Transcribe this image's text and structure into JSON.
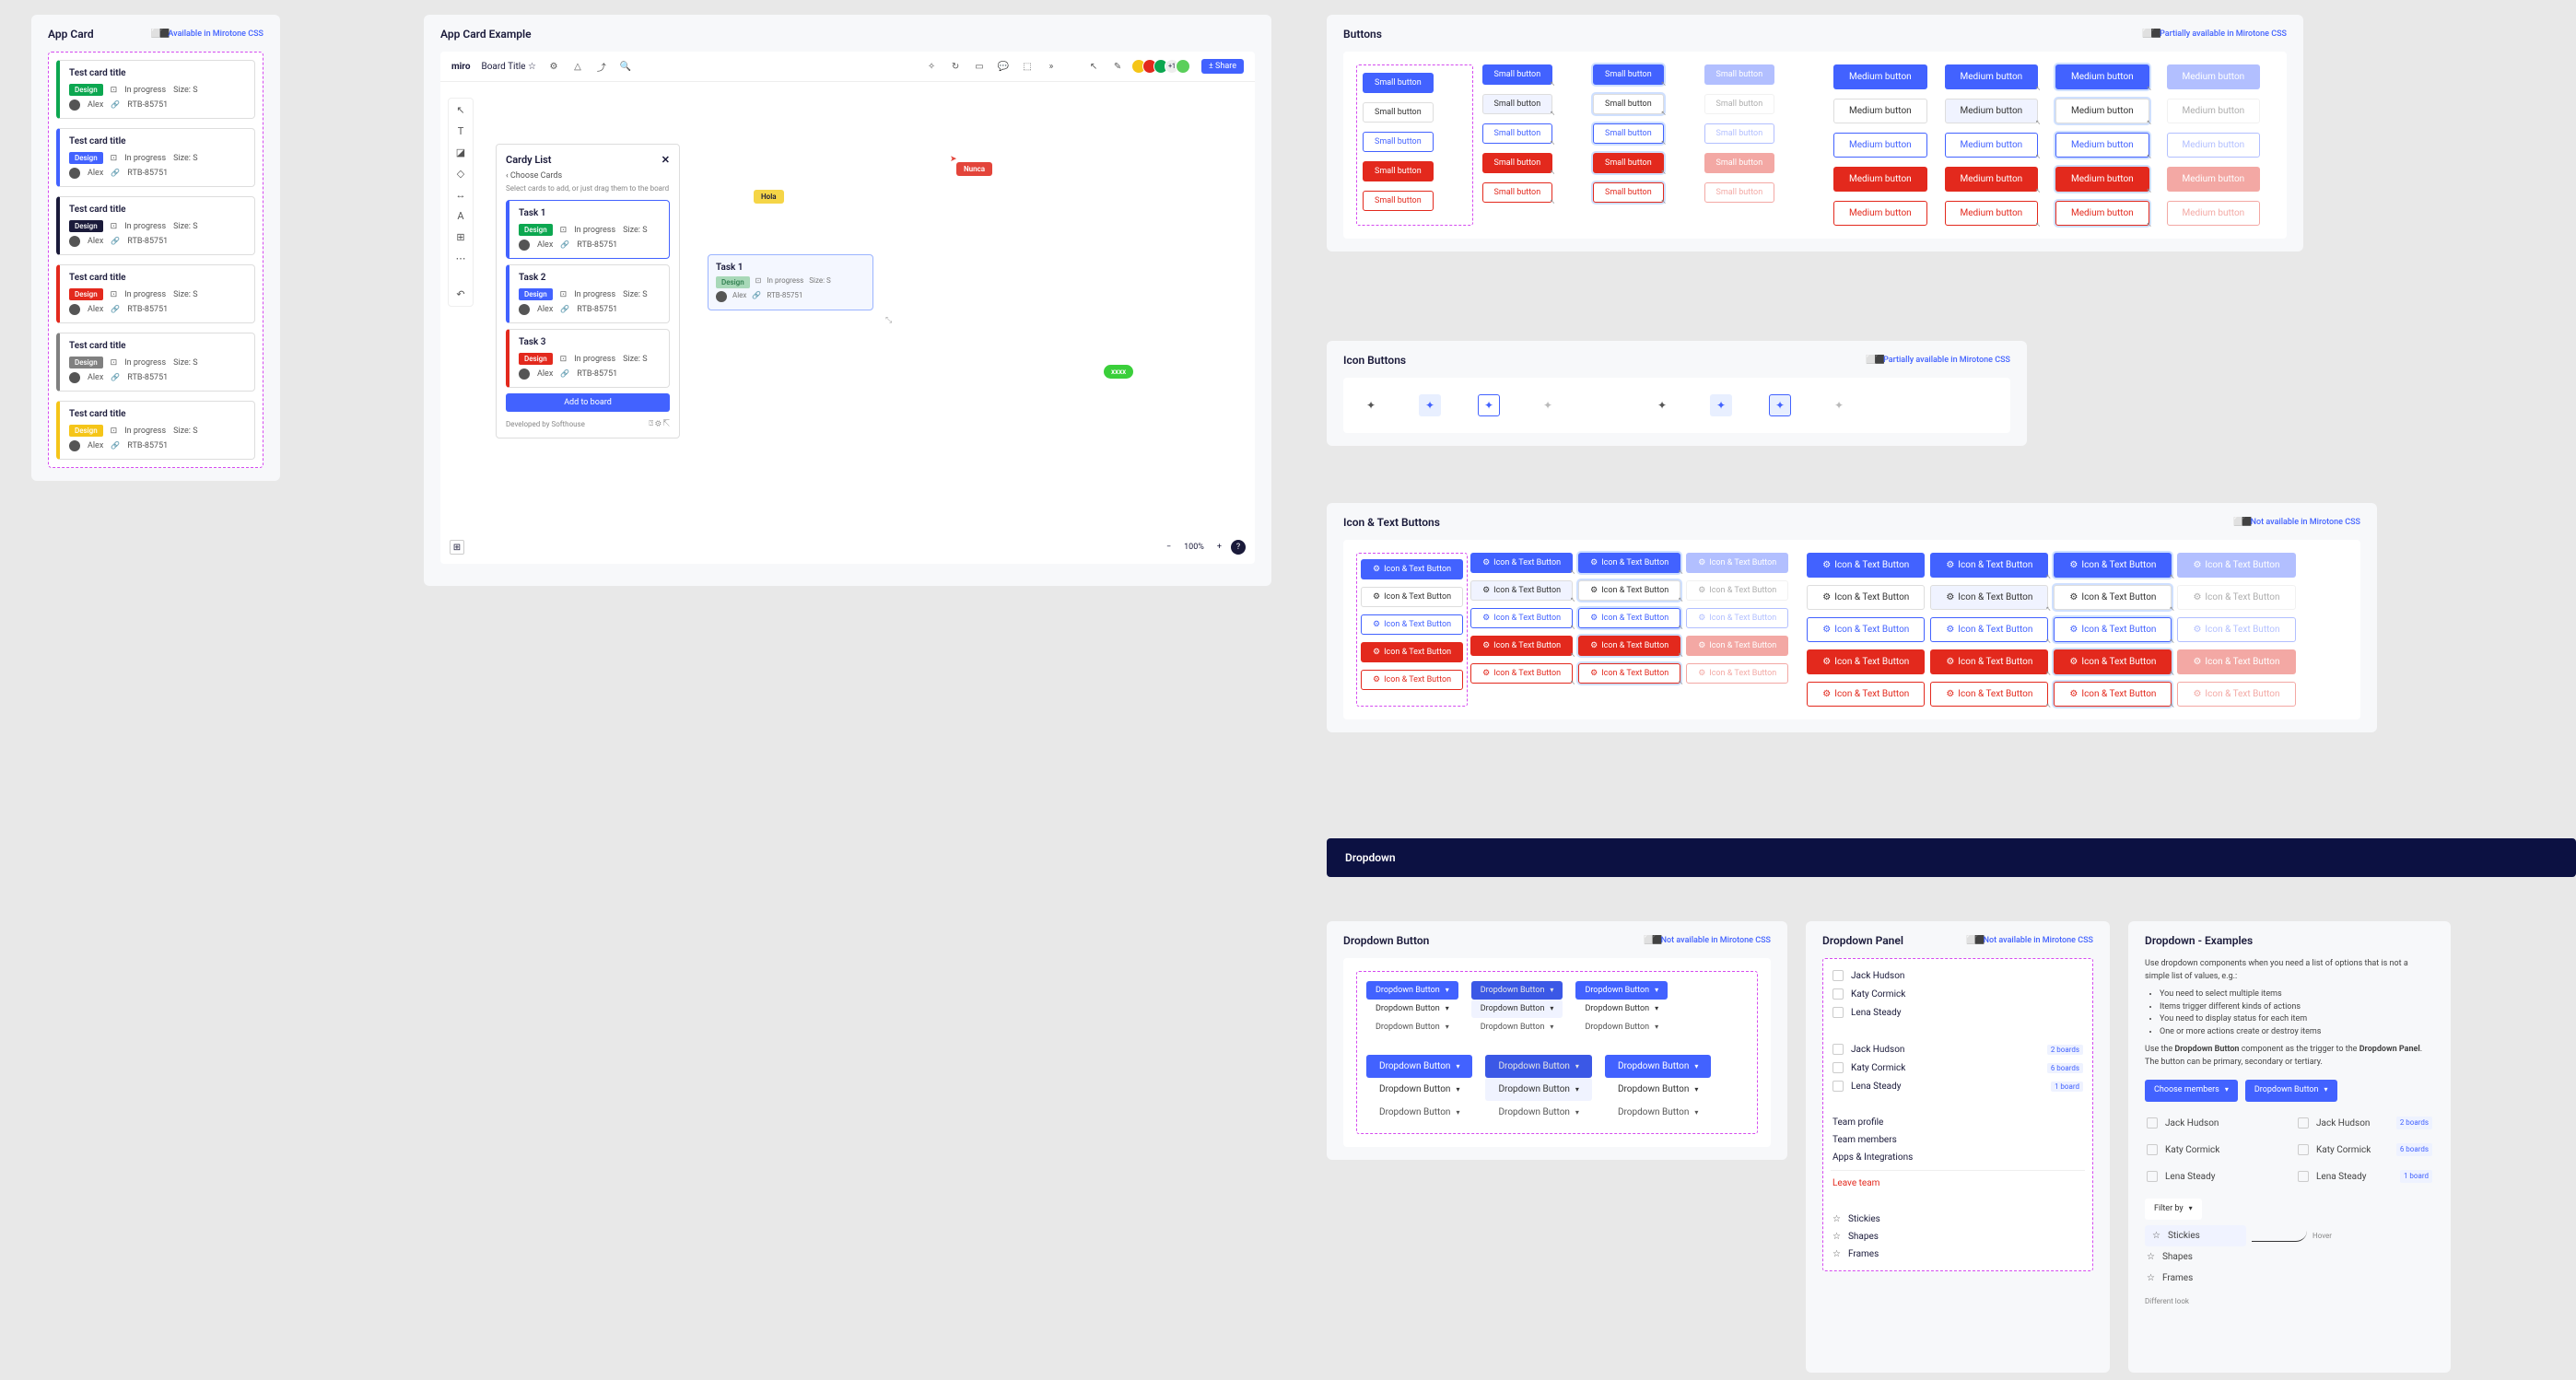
{
  "availability": {
    "available": "Available in Mirotone CSS",
    "partial": "Partially available in Mirotone CSS",
    "notAvailable": "Not available in Mirotone CSS"
  },
  "appCard": {
    "title": "App Card",
    "cards": [
      {
        "title": "Test card title",
        "tag": "Design",
        "color": "#0ca750",
        "status": "In progress",
        "size": "Size: S",
        "user": "Alex",
        "id": "RTB-85751"
      },
      {
        "title": "Test card title",
        "tag": "Design",
        "color": "#4262ff",
        "status": "In progress",
        "size": "Size: S",
        "user": "Alex",
        "id": "RTB-85751"
      },
      {
        "title": "Test card title",
        "tag": "Design",
        "color": "#1a1a3a",
        "status": "In progress",
        "size": "Size: S",
        "user": "Alex",
        "id": "RTB-85751"
      },
      {
        "title": "Test card title",
        "tag": "Design",
        "color": "#e3291d",
        "status": "In progress",
        "size": "Size: S",
        "user": "Alex",
        "id": "RTB-85751"
      },
      {
        "title": "Test card title",
        "tag": "Design",
        "color": "#808080",
        "status": "In progress",
        "size": "Size: S",
        "user": "Alex",
        "id": "RTB-85751",
        "border": "#1a1a3a"
      },
      {
        "title": "Test card title",
        "tag": "Design",
        "color": "#f5c518",
        "status": "In progress",
        "size": "Size: S",
        "user": "Alex",
        "id": "RTB-85751"
      }
    ]
  },
  "appExample": {
    "title": "App Card Example",
    "logo": "miro",
    "boardTitle": "Board Title ☆",
    "share": "± Share",
    "cardy": {
      "title": "Cardy List",
      "back": "‹  Choose Cards",
      "hint": "Select cards to add, or just drag them to the board",
      "tasks": [
        {
          "title": "Task 1",
          "tag": "Design",
          "color": "#0ca750",
          "status": "In progress",
          "size": "Size: S",
          "user": "Alex",
          "id": "RTB-85751"
        },
        {
          "title": "Task 2",
          "tag": "Design",
          "color": "#4262ff",
          "status": "In progress",
          "size": "Size: S",
          "user": "Alex",
          "id": "RTB-85751"
        },
        {
          "title": "Task 3",
          "tag": "Design",
          "color": "#e3291d",
          "status": "In progress",
          "size": "Size: S",
          "user": "Alex",
          "id": "RTB-85751"
        }
      ],
      "addBtn": "Add to board",
      "footer": "Developed by Softhouse"
    },
    "floatTask": {
      "title": "Task 1",
      "tag": "Design",
      "status": "In progress",
      "size": "Size: S",
      "user": "Alex",
      "id": "RTB-85751"
    },
    "stickies": {
      "yellow": "Hola",
      "red": "Nunca",
      "green": "xxxx"
    },
    "zoom": "100%"
  },
  "buttons": {
    "title": "Buttons",
    "small": "Small button",
    "medium": "Medium button"
  },
  "iconButtons": {
    "title": "Icon Buttons"
  },
  "iconText": {
    "title": "Icon & Text Buttons",
    "label": "Icon & Text Button"
  },
  "dropdown": {
    "header": "Dropdown",
    "ddBtn": {
      "title": "Dropdown Button",
      "label": "Dropdown Button"
    },
    "ddPanel": {
      "title": "Dropdown Panel",
      "people": [
        "Jack Hudson",
        "Katy Cormick",
        "Lena Steady"
      ],
      "peopleBoards": [
        {
          "name": "Jack Hudson",
          "boards": "2 boards"
        },
        {
          "name": "Katy Cormick",
          "boards": "6 boards"
        },
        {
          "name": "Lena Steady",
          "boards": "1 board"
        }
      ],
      "menu": [
        "Team profile",
        "Team members",
        "Apps & Integrations"
      ],
      "leave": "Leave team",
      "shapes": [
        "Stickies",
        "Shapes",
        "Frames"
      ]
    },
    "ddEx": {
      "title": "Dropdown - Examples",
      "intro": "Use dropdown components when you need a list of options that is not a simple list of values, e.g.:",
      "bullets": [
        "You need to select multiple items",
        "Items trigger different kinds of actions",
        "You need to display status for each item",
        "One or more actions create or destroy items"
      ],
      "body2a": "Use the ",
      "body2b": "Dropdown Button",
      "body2c": " component as the trigger to the ",
      "body2d": "Dropdown Panel",
      "body2e": ". The button can be primary, secondary or tertiary.",
      "choose": "Choose members",
      "ddBtn": "Dropdown Button",
      "filter": "Filter by",
      "hover": "Hover",
      "diff": "Different look"
    }
  }
}
